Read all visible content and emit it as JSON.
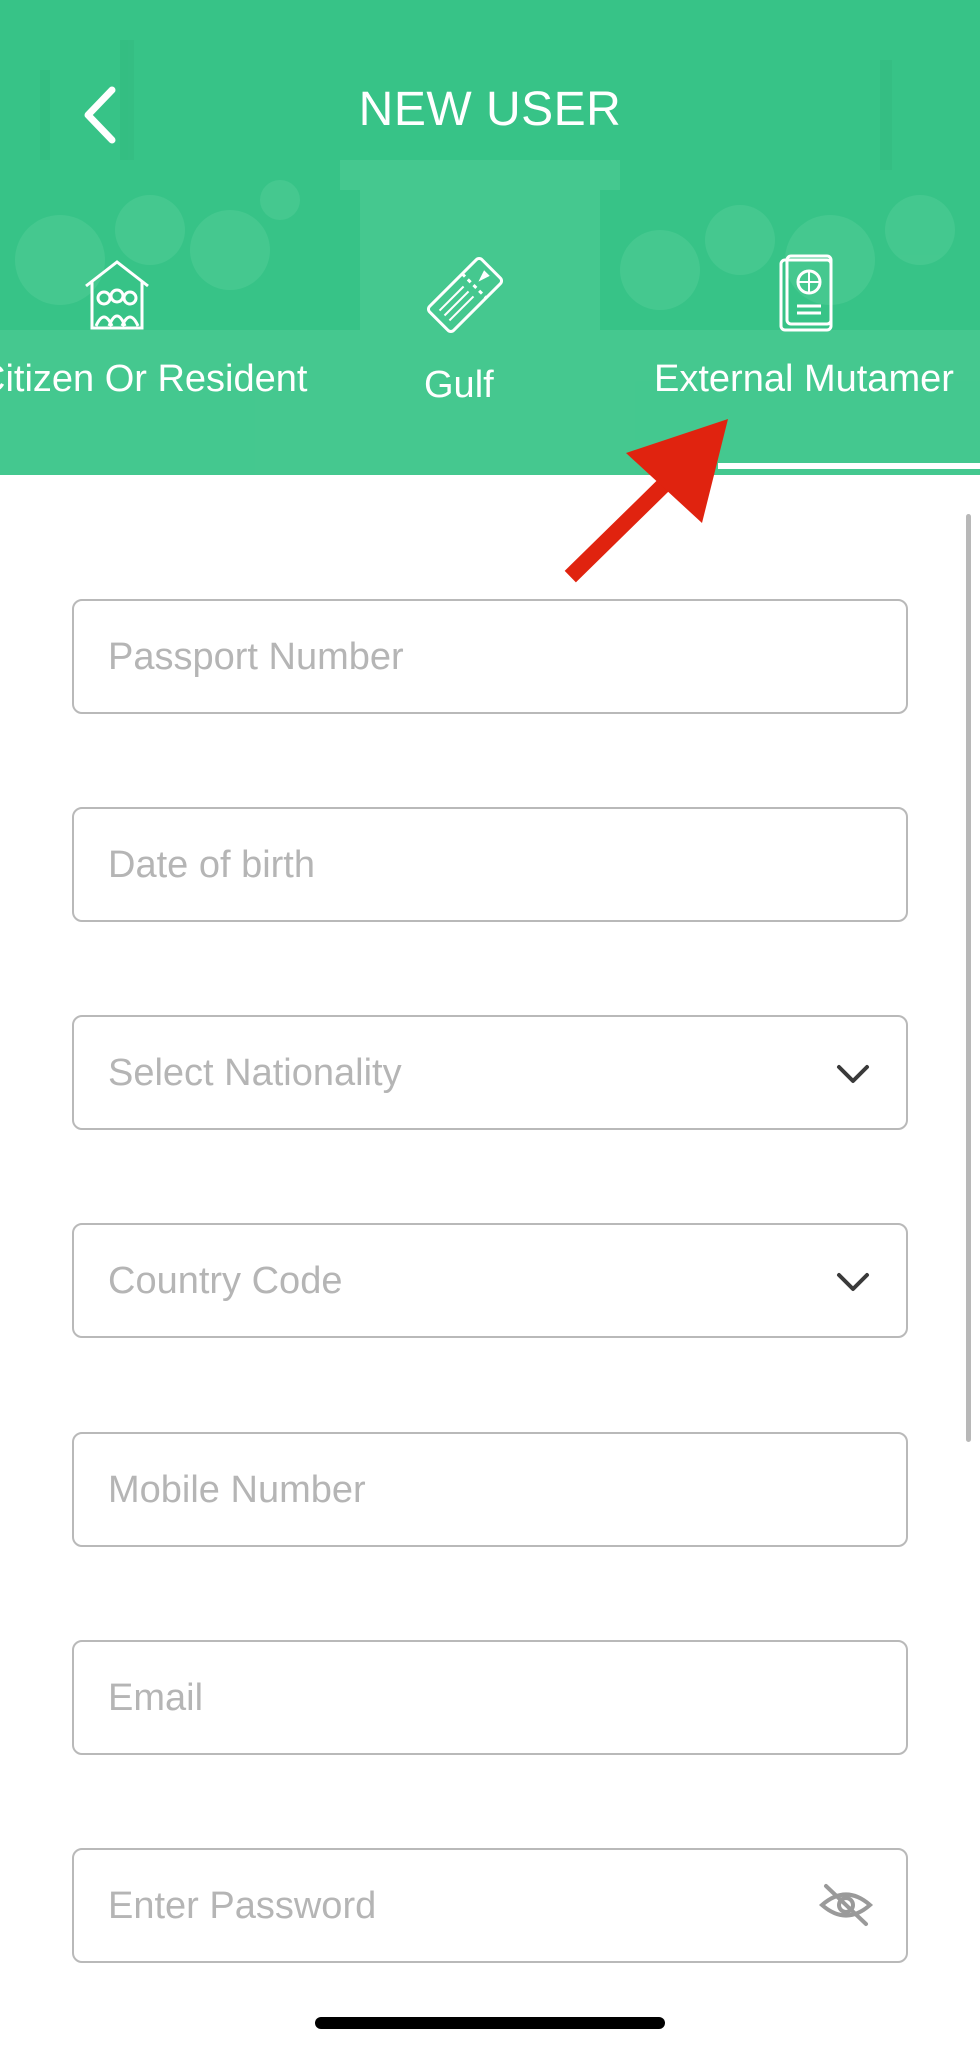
{
  "header": {
    "title": "NEW USER",
    "back_icon": "chevron-left-icon"
  },
  "tabs": [
    {
      "label": "Citizen Or Resident",
      "icon": "family-house-icon",
      "selected": false
    },
    {
      "label": "Gulf",
      "icon": "ticket-icon",
      "selected": false
    },
    {
      "label": "External Mutamer",
      "icon": "passport-icon",
      "selected": true
    }
  ],
  "form": {
    "passport_placeholder": "Passport Number",
    "dob_placeholder": "Date of birth",
    "nationality_placeholder": "Select Nationality",
    "country_code_placeholder": "Country Code",
    "mobile_placeholder": "Mobile Number",
    "email_placeholder": "Email",
    "password_placeholder": "Enter Password"
  },
  "colors": {
    "header_green": "#37c387",
    "annotation_arrow": "#e0230f",
    "border": "#b9b9b9",
    "placeholder": "#b5b5b5"
  }
}
